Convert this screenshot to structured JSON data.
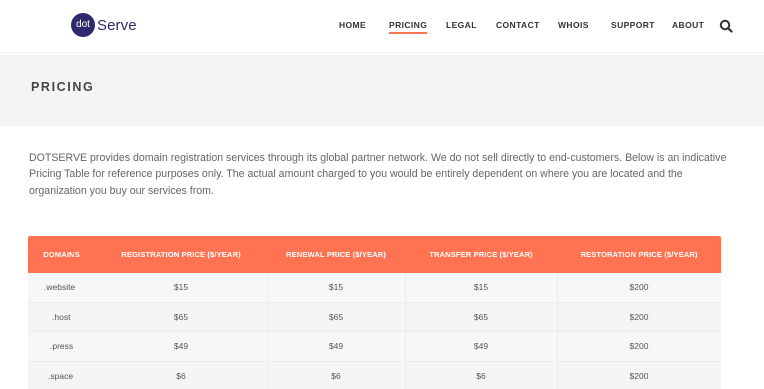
{
  "brand": {
    "logo_mark": "dot",
    "logo_text": "Serve"
  },
  "nav": {
    "items": [
      {
        "label": "HOME",
        "active": false
      },
      {
        "label": "PRICING",
        "active": true
      },
      {
        "label": "LEGAL",
        "active": false
      },
      {
        "label": "CONTACT",
        "active": false
      },
      {
        "label": "WHOIS",
        "active": false
      },
      {
        "label": "SUPPORT",
        "active": false
      },
      {
        "label": "ABOUT",
        "active": false
      }
    ],
    "search_icon": "search-icon",
    "accent_color": "#ff7451"
  },
  "hero": {
    "title": "PRICING"
  },
  "intro": {
    "text": "DOTSERVE provides domain registration services through its global partner network. We do not sell directly to end-customers. Below is an indicative Pricing Table for reference purposes only. The actual amount charged to you would be entirely dependent on where you are located and the organization you buy our services from."
  },
  "pricing_table": {
    "header_color": "#ff7352",
    "headers": [
      "DOMAINS",
      "REGISTRATION PRICE ($/YEAR)",
      "RENEWAL PRICE ($/YEAR)",
      "TRANSFER PRICE ($/YEAR)",
      "RESTORATION PRICE ($/YEAR)"
    ],
    "rows": [
      [
        ".website",
        "$15",
        "$15",
        "$15",
        "$200"
      ],
      [
        ".host",
        "$65",
        "$65",
        "$65",
        "$200"
      ],
      [
        ".press",
        "$49",
        "$49",
        "$49",
        "$200"
      ],
      [
        ".space",
        "$6",
        "$6",
        "$6",
        "$200"
      ]
    ]
  }
}
